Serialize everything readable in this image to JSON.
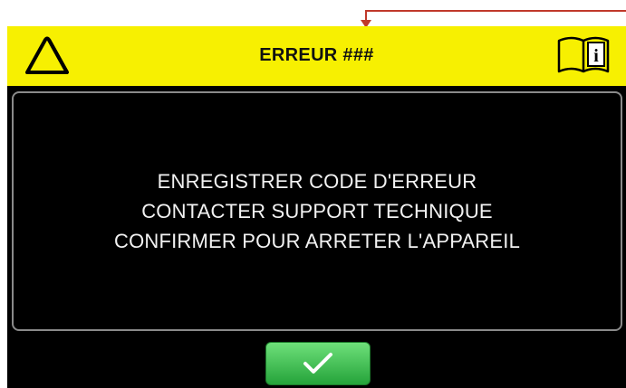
{
  "header": {
    "title": "ERREUR ###",
    "left_icon": "warning-triangle-icon",
    "right_icon": "manual-info-icon"
  },
  "message": {
    "lines": [
      "ENREGISTRER CODE D'ERREUR",
      "CONTACTER SUPPORT TECHNIQUE",
      "CONFIRMER POUR ARRETER L'APPAREIL"
    ]
  },
  "confirm_button": {
    "icon": "checkmark-icon"
  },
  "colors": {
    "header_bg": "#f7f001",
    "screen_bg": "#000000",
    "panel_border": "#8a8a8a",
    "button_green": "#3cbf4e",
    "callout_red": "#c0392b"
  }
}
